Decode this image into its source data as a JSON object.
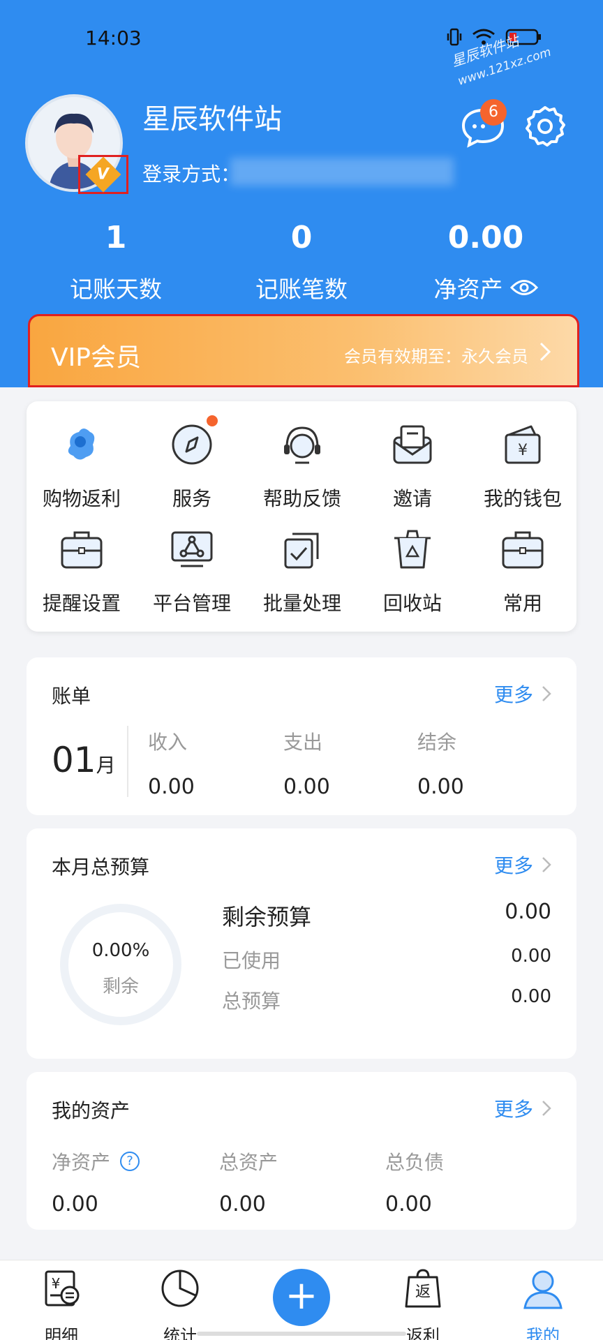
{
  "status_bar": {
    "time": "14:03"
  },
  "watermark": {
    "line1": "星辰软件站",
    "line2": "www.121xz.com"
  },
  "profile": {
    "username": "星辰软件站",
    "login_method": "登录方式：",
    "vip_badge": "V",
    "message_count": "6"
  },
  "stats": [
    {
      "value": "1",
      "label": "记账天数"
    },
    {
      "value": "0",
      "label": "记账笔数"
    },
    {
      "value": "0.00",
      "label": "净资产"
    }
  ],
  "vip": {
    "title": "VIP会员",
    "expiry": "会员有效期至：永久会员"
  },
  "grid": [
    {
      "label": "购物返利",
      "icon": "shopping-rebate-icon"
    },
    {
      "label": "服务",
      "icon": "compass-icon"
    },
    {
      "label": "帮助反馈",
      "icon": "headset-icon"
    },
    {
      "label": "邀请",
      "icon": "envelope-icon"
    },
    {
      "label": "我的钱包",
      "icon": "wallet-icon"
    },
    {
      "label": "提醒设置",
      "icon": "briefcase-icon"
    },
    {
      "label": "平台管理",
      "icon": "platform-icon"
    },
    {
      "label": "批量处理",
      "icon": "batch-check-icon"
    },
    {
      "label": "回收站",
      "icon": "trash-icon"
    },
    {
      "label": "常用",
      "icon": "briefcase-icon"
    }
  ],
  "bill": {
    "title": "账单",
    "more": "更多",
    "month": "01",
    "month_unit": "月",
    "columns": [
      {
        "header": "收入",
        "value": "0.00"
      },
      {
        "header": "支出",
        "value": "0.00"
      },
      {
        "header": "结余",
        "value": "0.00"
      }
    ]
  },
  "budget": {
    "title": "本月总预算",
    "more": "更多",
    "ring_percent": "0.00%",
    "ring_label": "剩余",
    "rows": [
      {
        "label": "剩余预算",
        "value": "0.00"
      },
      {
        "label": "已使用",
        "value": "0.00"
      },
      {
        "label": "总预算",
        "value": "0.00"
      }
    ]
  },
  "assets": {
    "title": "我的资产",
    "more": "更多",
    "help": "?",
    "columns": [
      {
        "header": "净资产",
        "value": "0.00"
      },
      {
        "header": "总资产",
        "value": "0.00"
      },
      {
        "header": "总负债",
        "value": "0.00"
      }
    ]
  },
  "nav": [
    {
      "label": "明细",
      "icon": "ledger-icon"
    },
    {
      "label": "统计",
      "icon": "pie-chart-icon"
    },
    {
      "label": "+",
      "icon": "add-icon"
    },
    {
      "label": "返利",
      "icon": "rebate-bag-icon"
    },
    {
      "label": "我的",
      "icon": "user-icon"
    }
  ],
  "colors": {
    "primary": "#2f8cf0",
    "vip_start": "#f9a640",
    "vip_end": "#fdd9a8",
    "badge": "#f5642d"
  }
}
